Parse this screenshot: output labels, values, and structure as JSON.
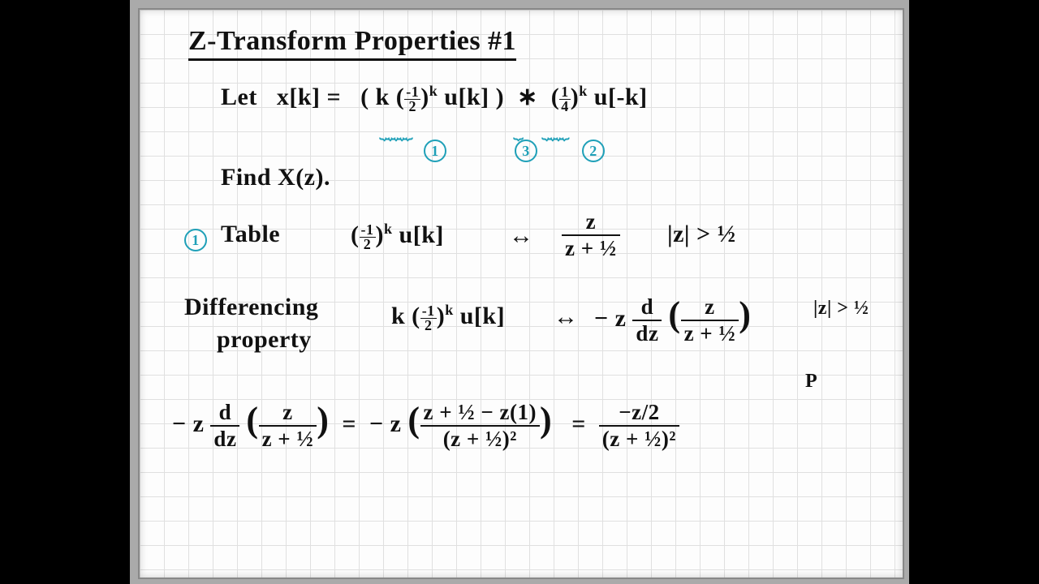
{
  "title": "Z-Transform Properties #1",
  "let_label": "Let",
  "xk": "x[k] =",
  "term1": "(k (<sfrac>-1/2</sfrac>)<sup>k</sup> u[k])",
  "conv": "∗",
  "term2": "(<sfrac>1/4</sfrac>)<sup>k</sup> u[-k]",
  "find": "Find X(z).",
  "circ1": "1",
  "circ2": "2",
  "circ3": "3",
  "step1_label": "Table",
  "step1_lhs": "(<sfrac>-1/2</sfrac>)<sup>k</sup> u[k]",
  "step1_rhs_num": "z",
  "step1_rhs_den": "z + ½",
  "roc": "|z| > ½",
  "diff_label1": "Differencing",
  "diff_label2": "property",
  "step2_lhs": "k (<sfrac>-1/2</sfrac>)<sup>k</sup> u[k]",
  "step2_rhs_pre": "− z",
  "step2_rhs_dd_n": "d",
  "step2_rhs_dd_d": "dz",
  "step3_mid_num": "z + ½ − z(1)",
  "step3_mid_den": "(z + ½)²",
  "step3_out_num": "−z/2",
  "step3_out_den": "(z + ½)²",
  "stray": "P"
}
